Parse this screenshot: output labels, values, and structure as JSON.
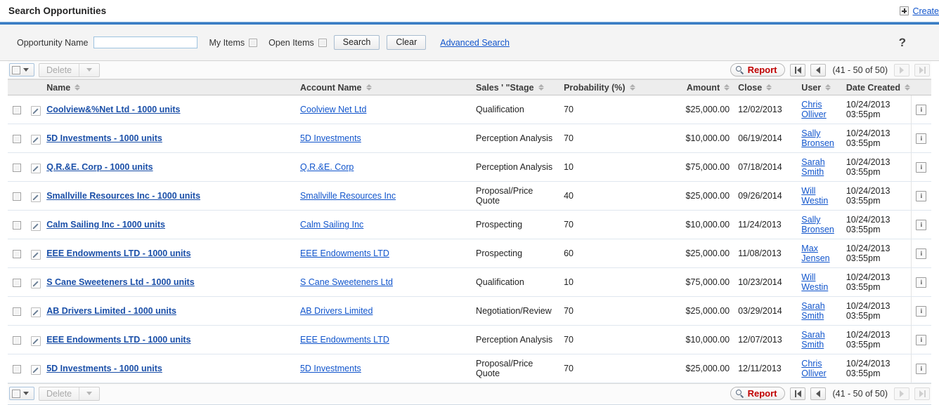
{
  "header": {
    "title": "Search Opportunities",
    "create_label": "Create",
    "plus_icon": "plus-icon"
  },
  "search": {
    "name_label": "Opportunity Name",
    "name_value": "",
    "name_placeholder": "",
    "my_items_label": "My Items",
    "open_items_label": "Open Items",
    "search_button": "Search",
    "clear_button": "Clear",
    "advanced_link": "Advanced Search",
    "help_glyph": "?"
  },
  "toolbar": {
    "delete_label": "Delete",
    "report_label": "Report",
    "pagination_text": "(41 - 50 of 50)",
    "first_icon": "first-page-icon",
    "prev_icon": "previous-page-icon",
    "next_icon": "next-page-icon",
    "last_icon": "last-page-icon",
    "magnifier_icon": "magnifier-icon"
  },
  "table": {
    "columns": [
      {
        "key": "name",
        "label": "Name"
      },
      {
        "key": "account",
        "label": "Account Name"
      },
      {
        "key": "stage",
        "label": "Sales ' \"Stage"
      },
      {
        "key": "probability",
        "label": "Probability (%)"
      },
      {
        "key": "amount",
        "label": "Amount"
      },
      {
        "key": "close",
        "label": "Close"
      },
      {
        "key": "user",
        "label": "User"
      },
      {
        "key": "created",
        "label": "Date Created"
      }
    ],
    "rows": [
      {
        "name": "Coolview&%Net Ltd - 1000 units",
        "account": "Coolview Net Ltd",
        "stage": "Qualification",
        "probability": "70",
        "amount": "$25,000.00",
        "close": "12/02/2013",
        "user_first": "Chris",
        "user_last": "Olliver",
        "created_date": "10/24/2013",
        "created_time": "03:55pm"
      },
      {
        "name": "5D Investments - 1000 units",
        "account": "5D Investments",
        "stage": "Perception Analysis",
        "probability": "70",
        "amount": "$10,000.00",
        "close": "06/19/2014",
        "user_first": "Sally",
        "user_last": "Bronsen",
        "created_date": "10/24/2013",
        "created_time": "03:55pm"
      },
      {
        "name": "Q.R.&E. Corp - 1000 units",
        "account": "Q.R.&E. Corp",
        "stage": "Perception Analysis",
        "probability": "10",
        "amount": "$75,000.00",
        "close": "07/18/2014",
        "user_first": "Sarah",
        "user_last": "Smith",
        "created_date": "10/24/2013",
        "created_time": "03:55pm"
      },
      {
        "name": "Smallville Resources Inc - 1000 units",
        "account": "Smallville Resources Inc",
        "stage": "Proposal/Price Quote",
        "probability": "40",
        "amount": "$25,000.00",
        "close": "09/26/2014",
        "user_first": "Will",
        "user_last": "Westin",
        "created_date": "10/24/2013",
        "created_time": "03:55pm"
      },
      {
        "name": "Calm Sailing Inc - 1000 units",
        "account": "Calm Sailing Inc",
        "stage": "Prospecting",
        "probability": "70",
        "amount": "$10,000.00",
        "close": "11/24/2013",
        "user_first": "Sally",
        "user_last": "Bronsen",
        "created_date": "10/24/2013",
        "created_time": "03:55pm"
      },
      {
        "name": "EEE Endowments LTD - 1000 units",
        "account": "EEE Endowments LTD",
        "stage": "Prospecting",
        "probability": "60",
        "amount": "$25,000.00",
        "close": "11/08/2013",
        "user_first": "Max",
        "user_last": "Jensen",
        "created_date": "10/24/2013",
        "created_time": "03:55pm"
      },
      {
        "name": "S Cane Sweeteners Ltd - 1000 units",
        "account": "S Cane Sweeteners Ltd",
        "stage": "Qualification",
        "probability": "10",
        "amount": "$75,000.00",
        "close": "10/23/2014",
        "user_first": "Will",
        "user_last": "Westin",
        "created_date": "10/24/2013",
        "created_time": "03:55pm"
      },
      {
        "name": "AB Drivers Limited - 1000 units",
        "account": "AB Drivers Limited",
        "stage": "Negotiation/Review",
        "probability": "70",
        "amount": "$25,000.00",
        "close": "03/29/2014",
        "user_first": "Sarah",
        "user_last": "Smith",
        "created_date": "10/24/2013",
        "created_time": "03:55pm"
      },
      {
        "name": "EEE Endowments LTD - 1000 units",
        "account": "EEE Endowments LTD",
        "stage": "Perception Analysis",
        "probability": "70",
        "amount": "$10,000.00",
        "close": "12/07/2013",
        "user_first": "Sarah",
        "user_last": "Smith",
        "created_date": "10/24/2013",
        "created_time": "03:55pm"
      },
      {
        "name": "5D Investments - 1000 units",
        "account": "5D Investments",
        "stage": "Proposal/Price Quote",
        "probability": "70",
        "amount": "$25,000.00",
        "close": "12/11/2013",
        "user_first": "Chris",
        "user_last": "Olliver",
        "created_date": "10/24/2013",
        "created_time": "03:55pm"
      }
    ]
  },
  "colors": {
    "link": "#1155cc",
    "accent_rule": "#3a7dc4",
    "report_red": "#c00000",
    "header_bg": "#ededed"
  }
}
